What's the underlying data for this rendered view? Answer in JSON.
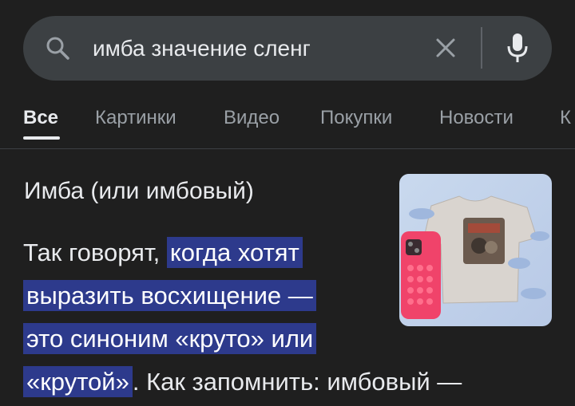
{
  "search": {
    "query": "имба значение сленг"
  },
  "tabs": [
    {
      "label": "Все",
      "active": true
    },
    {
      "label": "Картинки",
      "active": false
    },
    {
      "label": "Видео",
      "active": false
    },
    {
      "label": "Покупки",
      "active": false
    },
    {
      "label": "Новости",
      "active": false
    },
    {
      "label": "К",
      "active": false
    }
  ],
  "result": {
    "title": "Имба (или имбовый)",
    "snippet_lines": [
      {
        "plain": "Так говорят, ",
        "highlight": "когда хотят",
        "rest": ""
      },
      {
        "plain": "",
        "highlight": "выразить восхищение —",
        "rest": ""
      },
      {
        "plain": "",
        "highlight": "это синоним «круто» или",
        "rest": ""
      },
      {
        "plain": "",
        "highlight": "«крутой»",
        "rest": ". Как запомнить: имбовый —"
      }
    ]
  },
  "colors": {
    "background": "#1f1f1f",
    "search_bar": "#3c4043",
    "highlight": "#2d3a8c",
    "text": "#e8eaed",
    "muted": "#9aa0a6"
  }
}
